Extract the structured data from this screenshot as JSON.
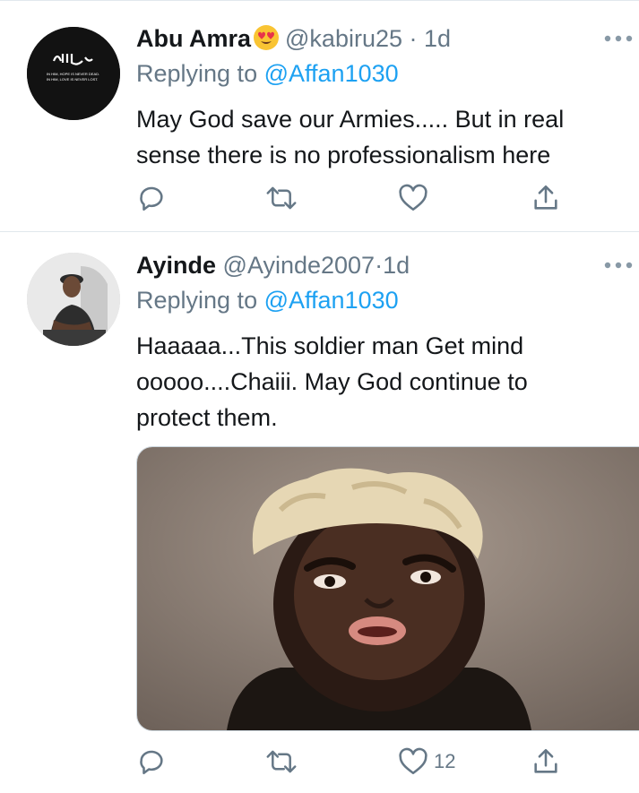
{
  "tweets": [
    {
      "name": "Abu Amra",
      "emoji": "heart-eyes-emoji",
      "handle": "@kabiru25",
      "dot": "·",
      "time": "1d",
      "replying_prefix": "Replying to",
      "replying_to": "@Affan1030",
      "text_line1": "May God save our Armies..... But in real",
      "text_line2": "sense there is no professionalism here",
      "avatar_caption1": "IN HIM, HOPE IS NEVER DEAD.",
      "avatar_caption2": "IN HIM, LOVE IS NEVER LOST.",
      "like_count": ""
    },
    {
      "name": "Ayinde",
      "handle": "@Ayinde2007",
      "dot": "·",
      "time": "1d",
      "replying_prefix": "Replying to",
      "replying_to": "@Affan1030",
      "text_line1": "Haaaaa...This soldier man Get mind",
      "text_line2": "ooooo....Chaiii. May God continue to",
      "text_line3": "protect them.",
      "like_count": "12"
    }
  ],
  "colors": {
    "accent": "#1da1f2",
    "secondary_text": "#657786",
    "primary_text": "#14171a",
    "divider": "#e1e8ed"
  },
  "icons": [
    "reply-icon",
    "retweet-icon",
    "like-icon",
    "share-icon",
    "more-icon"
  ]
}
